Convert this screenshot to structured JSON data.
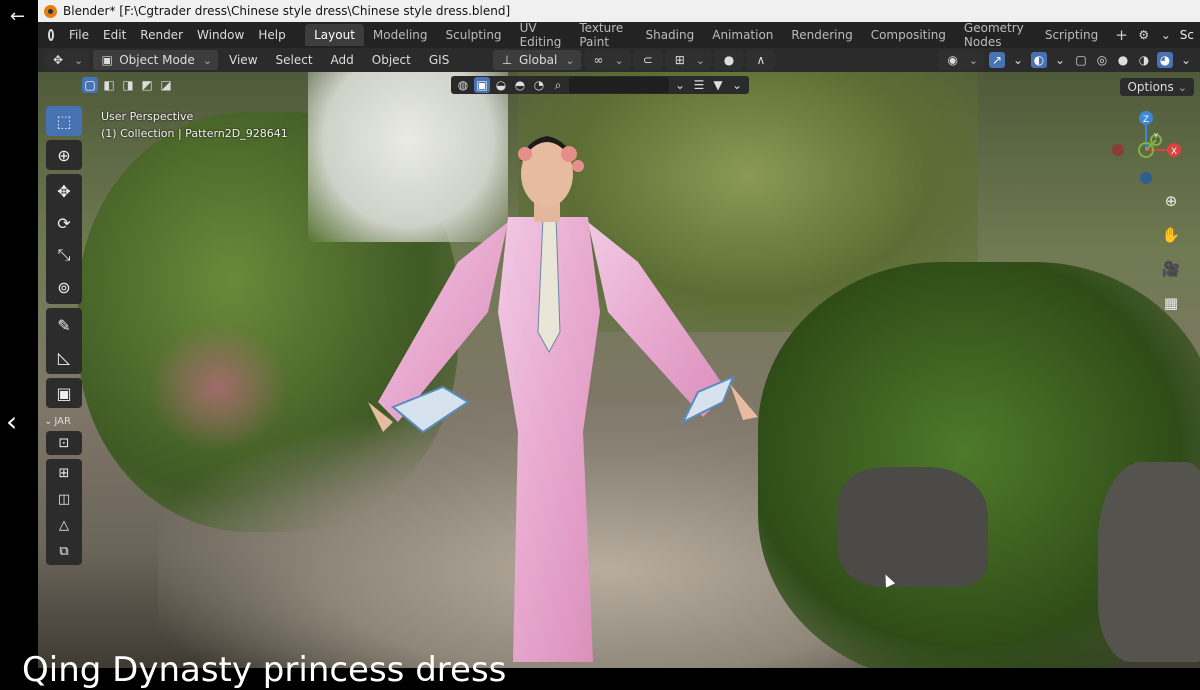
{
  "window": {
    "title": "Blender* [F:\\Cgtrader dress\\Chinese style dress\\Chinese style dress.blend]"
  },
  "menu": [
    "File",
    "Edit",
    "Render",
    "Window",
    "Help"
  ],
  "workspace_tabs": [
    "Layout",
    "Modeling",
    "Sculpting",
    "UV Editing",
    "Texture Paint",
    "Shading",
    "Animation",
    "Rendering",
    "Compositing",
    "Geometry Nodes",
    "Scripting"
  ],
  "workspace_right": "Sc",
  "header": {
    "mode": "Object Mode",
    "menus": [
      "View",
      "Select",
      "Add",
      "Object",
      "GIS"
    ],
    "orientation": "Global"
  },
  "options_label": "Options",
  "viewport": {
    "perspective": "User Perspective",
    "collection": "(1) Collection | Pattern2D_928641"
  },
  "toolbar": {
    "addon_label": "JAR"
  },
  "gizmo": {
    "z": "Z",
    "y": "Y",
    "x": "X"
  },
  "caption": "Qing Dynasty princess dress",
  "colors": {
    "accent": "#4772b3",
    "x_axis": "#d9423f",
    "y_axis": "#7fb341",
    "z_axis": "#3f86d9"
  },
  "icons": [
    "blender-logo-icon",
    "back-arrow-icon",
    "chevron-left-icon",
    "select-box-icon",
    "cursor-icon",
    "move-icon",
    "rotate-icon",
    "scale-icon",
    "transform-icon",
    "annotate-icon",
    "measure-icon",
    "add-cube-icon",
    "zoom-icon",
    "hand-icon",
    "camera-icon",
    "grid-icon",
    "filter-icon",
    "search-icon"
  ]
}
